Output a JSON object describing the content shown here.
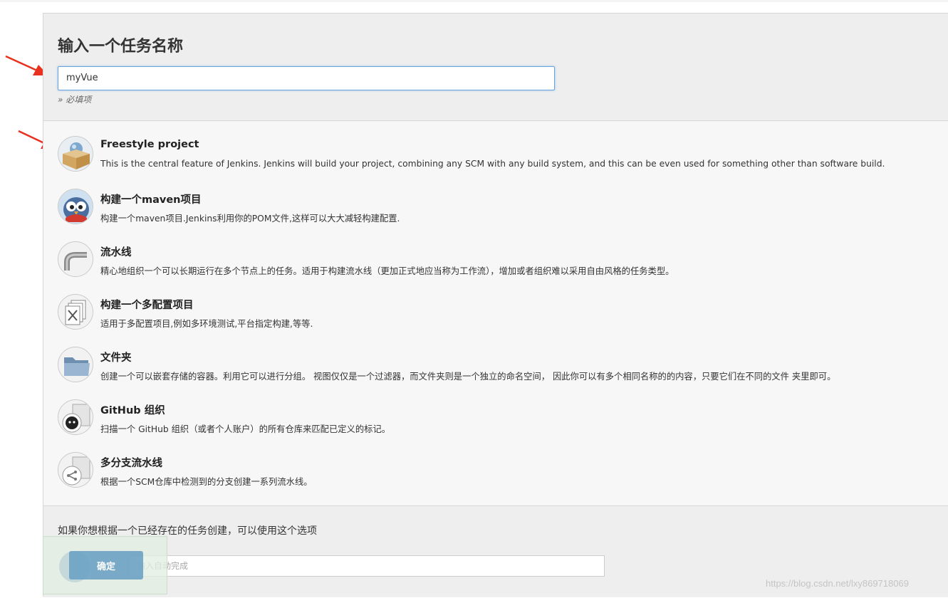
{
  "header": {
    "title": "输入一个任务名称",
    "name_value": "myVue",
    "required_hint": "» 必填项"
  },
  "project_types": [
    {
      "title": "Freestyle project",
      "desc": "This is the central feature of Jenkins. Jenkins will build your project, combining any SCM with any build system, and this can be even used for something other than software build.",
      "icon": "freestyle-box-icon"
    },
    {
      "title": "构建一个maven项目",
      "desc": "构建一个maven项目.Jenkins利用你的POM文件,这样可以大大减轻构建配置.",
      "icon": "maven-owl-icon"
    },
    {
      "title": "流水线",
      "desc": "精心地组织一个可以长期运行在多个节点上的任务。适用于构建流水线（更加正式地应当称为工作流），增加或者组织难以采用自由风格的任务类型。",
      "icon": "pipeline-pipe-icon"
    },
    {
      "title": "构建一个多配置项目",
      "desc": "适用于多配置项目,例如多环境测试,平台指定构建,等等.",
      "icon": "multi-config-icon"
    },
    {
      "title": "文件夹",
      "desc": "创建一个可以嵌套存储的容器。利用它可以进行分组。 视图仅仅是一个过滤器，而文件夹则是一个独立的命名空间， 因此你可以有多个相同名称的的内容，只要它们在不同的文件 夹里即可。",
      "icon": "folder-icon"
    },
    {
      "title": "GitHub 组织",
      "desc": "扫描一个 GitHub 组织（或者个人账户）的所有仓库来匹配已定义的标记。",
      "icon": "github-octocat-icon"
    },
    {
      "title": "多分支流水线",
      "desc": "根据一个SCM仓库中检测到的分支创建一系列流水线。",
      "icon": "multibranch-icon"
    }
  ],
  "copy": {
    "label": "如果你想根据一个已经存在的任务创建，可以使用这个选项",
    "placeholder": "输入自动完成"
  },
  "ok_button": "确定",
  "watermark": "https://blog.csdn.net/lxy869718069",
  "colors": {
    "accent": "#6aa1c4",
    "annotation_arrow": "#e8311f",
    "input_focus": "#66a3e0"
  }
}
